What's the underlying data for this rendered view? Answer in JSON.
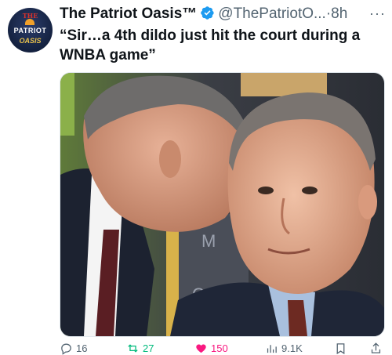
{
  "author": {
    "display_name": "The Patriot Oasis™",
    "handle": "@ThePatriotO...",
    "separator": "·",
    "time": "8h",
    "avatar_text": {
      "top": "THE",
      "middle": "PATRIOT",
      "bottom": "OASIS"
    },
    "verified_color": "#1d9bf0"
  },
  "tweet": {
    "text": "“Sir…a 4th dildo just hit the court during a WNBA game”"
  },
  "media": {
    "description_icon": "photo"
  },
  "actions": {
    "replies": "16",
    "reposts": "27",
    "likes": "150",
    "views": "9.1K"
  },
  "colors": {
    "like": "#f91880",
    "repost": "#00ba7c",
    "muted": "#536471"
  }
}
